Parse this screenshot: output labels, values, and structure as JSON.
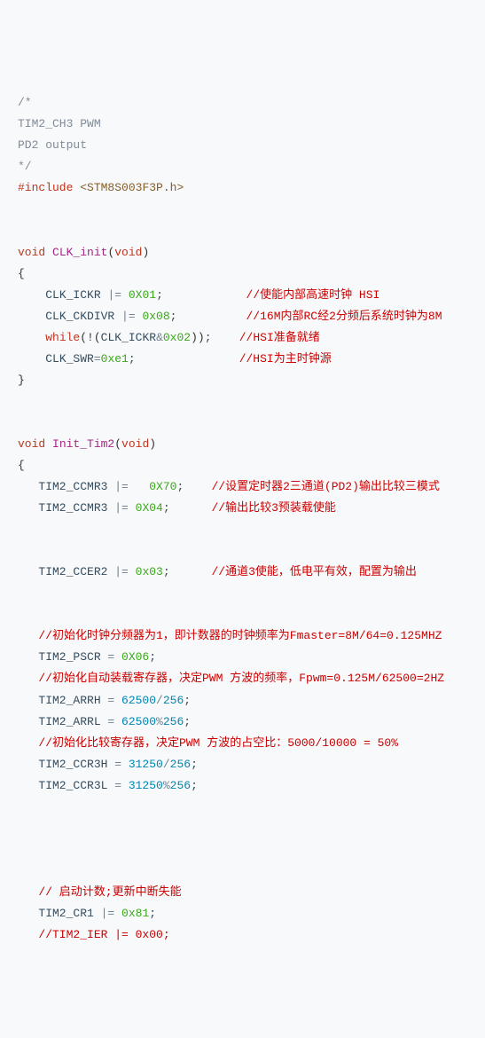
{
  "code": {
    "c1": "/*",
    "c2": "TIM2_CH3 PWM",
    "c3": "PD2 output",
    "c4": "*/",
    "inc_kw": "#include",
    "inc_lt": " <",
    "inc_file": "STM8S003F3P.h",
    "inc_gt": ">",
    "void1": "void",
    "fn1": " CLK_init",
    "paren_open": "(",
    "void_arg": "void",
    "paren_close": ")",
    "brace_open": "{",
    "brace_close": "}",
    "clk_ickr": "CLK_ICKR",
    "oreq": " |= ",
    "eqop": "=",
    "h0x01": "0X01",
    "semi": ";",
    "cm_clk1": "//使能内部高速时钟 HSI",
    "clk_ckdivr": "CLK_CKDIVR",
    "h0x08": "0x08",
    "cm_clk2": "//16M内部RC经2分频后系统时钟为8M",
    "while_kw": "while",
    "while_inner_a": "(!(",
    "clk_ickr2": "CLK_ICKR",
    "amp": "&",
    "h0x02": "0x02",
    "while_inner_b": "))",
    "cm_clk3": "//HSI准备就绪",
    "clk_swr": "CLK_SWR",
    "h0xe1": "0xe1",
    "cm_clk4": "//HSI为主时钟源",
    "fn2": " Init_Tim2",
    "tim2_ccmr3": "TIM2_CCMR3",
    "oreq_sp": " |=   ",
    "h0x70": "0X70",
    "cm_t1": "//设置定时器2三通道(PD2)输出比较三模式",
    "h0x04": "0X04",
    "cm_t2": "//输出比较3预装载使能",
    "tim2_ccer2": "TIM2_CCER2",
    "h0x03": "0x03",
    "cm_t3": "//通道3使能，低电平有效，配置为输出",
    "cm_t4": "//初始化时钟分频器为1，即计数器的时钟频率为Fmaster=8M/64=0.125MHZ",
    "tim2_pscr": "TIM2_PSCR",
    "eq": " = ",
    "h0x06": "0X06",
    "cm_t5": "//初始化自动装载寄存器，决定PWM 方波的频率，Fpwm=0.125M/62500=2HZ",
    "tim2_arrh": "TIM2_ARRH",
    "n62500": "62500",
    "n256": "256",
    "div": "/",
    "mod": "%",
    "tim2_arrl": "TIM2_ARRL",
    "cm_t6": "//初始化比较寄存器，决定PWM 方波的占空比：5000/10000 = 50%",
    "tim2_ccr3h": "TIM2_CCR3H",
    "tim2_ccr3l": "TIM2_CCR3L",
    "n31250": "31250",
    "cm_t7": "// 启动计数;更新中断失能",
    "tim2_cr1": "TIM2_CR1",
    "h0x81": "0x81",
    "cm_t8": "//TIM2_IER |= 0x00;"
  }
}
